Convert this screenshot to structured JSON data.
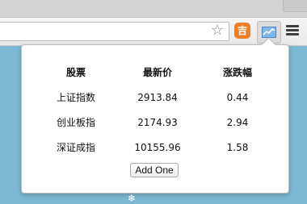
{
  "toolbar": {
    "extension_badge_text": "吉",
    "icons": [
      "star-icon",
      "puzzle-extension-icon",
      "stock-chart-icon",
      "hamburger-menu-icon"
    ]
  },
  "popup": {
    "headers": [
      "股票",
      "最新价",
      "涨跌幅"
    ],
    "rows": [
      {
        "name": "上证指数",
        "price": "2913.84",
        "change": "0.44"
      },
      {
        "name": "创业板指",
        "price": "2174.93",
        "change": "2.94"
      },
      {
        "name": "深证成指",
        "price": "10155.96",
        "change": "1.58"
      }
    ],
    "add_button_label": "Add One"
  },
  "colors": {
    "page_background": "#7cb8d4",
    "extension_orange": "#ef7d2a"
  }
}
